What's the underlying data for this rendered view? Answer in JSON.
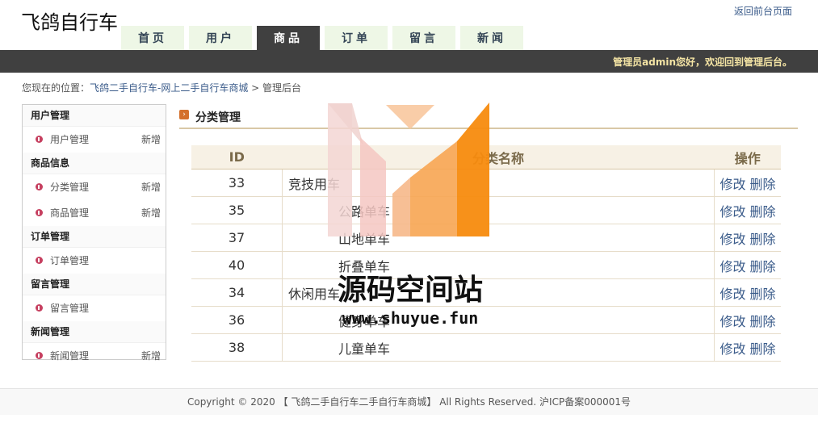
{
  "site": {
    "title": "飞鸽自行车",
    "back_link": "返回前台页面"
  },
  "nav": {
    "tabs": [
      "首页",
      "用户",
      "商品",
      "订单",
      "留言",
      "新闻"
    ],
    "active": "商品"
  },
  "topbar": {
    "welcome": "管理员admin您好，欢迎回到管理后台。"
  },
  "breadcrumb": {
    "prefix": "您现在的位置：",
    "site": "飞鸽二手自行车-网上二手自行车商城",
    "sep": " > ",
    "current": "管理后台"
  },
  "sidebar": [
    {
      "group": "用户管理",
      "items": [
        {
          "label": "用户管理",
          "add": "新增"
        }
      ]
    },
    {
      "group": "商品信息",
      "items": [
        {
          "label": "分类管理",
          "add": "新增"
        },
        {
          "label": "商品管理",
          "add": "新增"
        }
      ]
    },
    {
      "group": "订单管理",
      "items": [
        {
          "label": "订单管理",
          "add": ""
        }
      ]
    },
    {
      "group": "留言管理",
      "items": [
        {
          "label": "留言管理",
          "add": ""
        }
      ]
    },
    {
      "group": "新闻管理",
      "items": [
        {
          "label": "新闻管理",
          "add": "新增"
        }
      ]
    }
  ],
  "panel": {
    "title": "分类管理"
  },
  "table": {
    "headers": {
      "id": "ID",
      "name": "分类名称",
      "ops": "操作"
    },
    "edit_label": "修改",
    "delete_label": "删除",
    "rows": [
      {
        "id": "33",
        "name": "竞技用车",
        "level": "parent"
      },
      {
        "id": "35",
        "name": "公路单车",
        "level": "child"
      },
      {
        "id": "37",
        "name": "山地单车",
        "level": "child"
      },
      {
        "id": "40",
        "name": "折叠单车",
        "level": "child"
      },
      {
        "id": "34",
        "name": "休闲用车",
        "level": "parent"
      },
      {
        "id": "36",
        "name": "健身单车",
        "level": "child"
      },
      {
        "id": "38",
        "name": "儿童单车",
        "level": "child"
      }
    ]
  },
  "footer": {
    "text": "Copyright © 2020 【 飞鸽二手自行车二手自行车商城】 All Rights Reserved. 沪ICP备案000001号"
  },
  "watermark": {
    "text": "源码空间站",
    "url": "www.shuyue.fun"
  },
  "colors": {
    "topbar": "#404040",
    "nav_tab": "#eef7e6",
    "accent": "#f7931e",
    "link": "#3a5b8a"
  }
}
